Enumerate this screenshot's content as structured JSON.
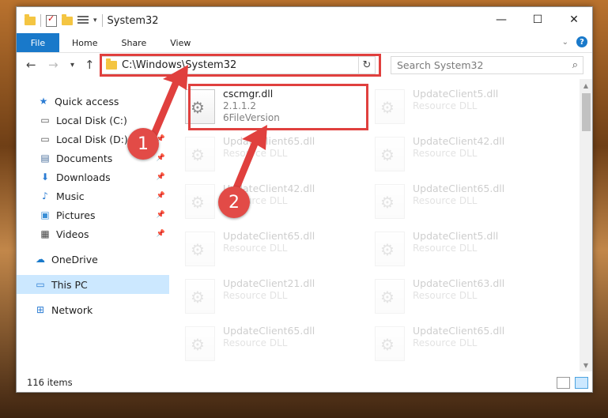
{
  "window": {
    "title": "System32",
    "controls": {
      "minimize": "—",
      "maximize": "☐",
      "close": "✕"
    }
  },
  "ribbon": {
    "tabs": [
      "File",
      "Home",
      "Share",
      "View"
    ]
  },
  "nav": {
    "back": "←",
    "forward": "→",
    "recent": "▾",
    "up": "↑",
    "address": "C:\\Windows\\System32",
    "refresh": "↻",
    "search_placeholder": "Search System32",
    "search_icon": "⌕"
  },
  "sidebar": {
    "items": [
      {
        "label": "Quick access",
        "icon": "star-icon",
        "glyph": "★",
        "color": "#2b7cd3"
      },
      {
        "label": "Local Disk (C:)",
        "icon": "drive-icon",
        "glyph": "▭",
        "color": "#555555",
        "pinned": true
      },
      {
        "label": "Local Disk (D:)",
        "icon": "drive-icon",
        "glyph": "▭",
        "color": "#555555",
        "pinned": true
      },
      {
        "label": "Documents",
        "icon": "documents-icon",
        "glyph": "▤",
        "color": "#4a6f9c",
        "pinned": true
      },
      {
        "label": "Downloads",
        "icon": "download-icon",
        "glyph": "⬇",
        "color": "#2b7cd3",
        "pinned": true
      },
      {
        "label": "Music",
        "icon": "music-icon",
        "glyph": "♪",
        "color": "#2b7cd3",
        "pinned": true
      },
      {
        "label": "Pictures",
        "icon": "pictures-icon",
        "glyph": "▣",
        "color": "#3a8fd6",
        "pinned": true
      },
      {
        "label": "Videos",
        "icon": "videos-icon",
        "glyph": "▦",
        "color": "#444444",
        "pinned": true
      },
      {
        "label": "OneDrive",
        "icon": "cloud-icon",
        "glyph": "☁",
        "color": "#1979ca"
      },
      {
        "label": "This PC",
        "icon": "computer-icon",
        "glyph": "▭",
        "color": "#2b7cd3",
        "selected": true
      },
      {
        "label": "Network",
        "icon": "network-icon",
        "glyph": "⊞",
        "color": "#2b7cd3"
      }
    ],
    "pin_glyph": "📌"
  },
  "files": [
    {
      "name": "cscmgr.dll",
      "line2": "2.1.1.2",
      "line3": "6FileVersion",
      "highlighted": true
    },
    {
      "name": "UpdateClient5.dll",
      "line2": "Resource DLL"
    },
    {
      "name": "UpdateClient65.dll",
      "line2": "Resource DLL"
    },
    {
      "name": "UpdateClient42.dll",
      "line2": "Resource DLL"
    },
    {
      "name": "UpdateClient42.dll",
      "line2": "Resource DLL"
    },
    {
      "name": "UpdateClient65.dll",
      "line2": "Resource DLL"
    },
    {
      "name": "UpdateClient65.dll",
      "line2": "Resource DLL"
    },
    {
      "name": "UpdateClient5.dll",
      "line2": "Resource DLL"
    },
    {
      "name": "UpdateClient21.dll",
      "line2": "Resource DLL"
    },
    {
      "name": "UpdateClient63.dll",
      "line2": "Resource DLL"
    },
    {
      "name": "UpdateClient65.dll",
      "line2": "Resource DLL"
    },
    {
      "name": "UpdateClient65.dll",
      "line2": "Resource DLL"
    }
  ],
  "status": {
    "items": "116 items"
  },
  "annotations": {
    "badge1": "1",
    "badge2": "2",
    "color": "#e0403e"
  }
}
